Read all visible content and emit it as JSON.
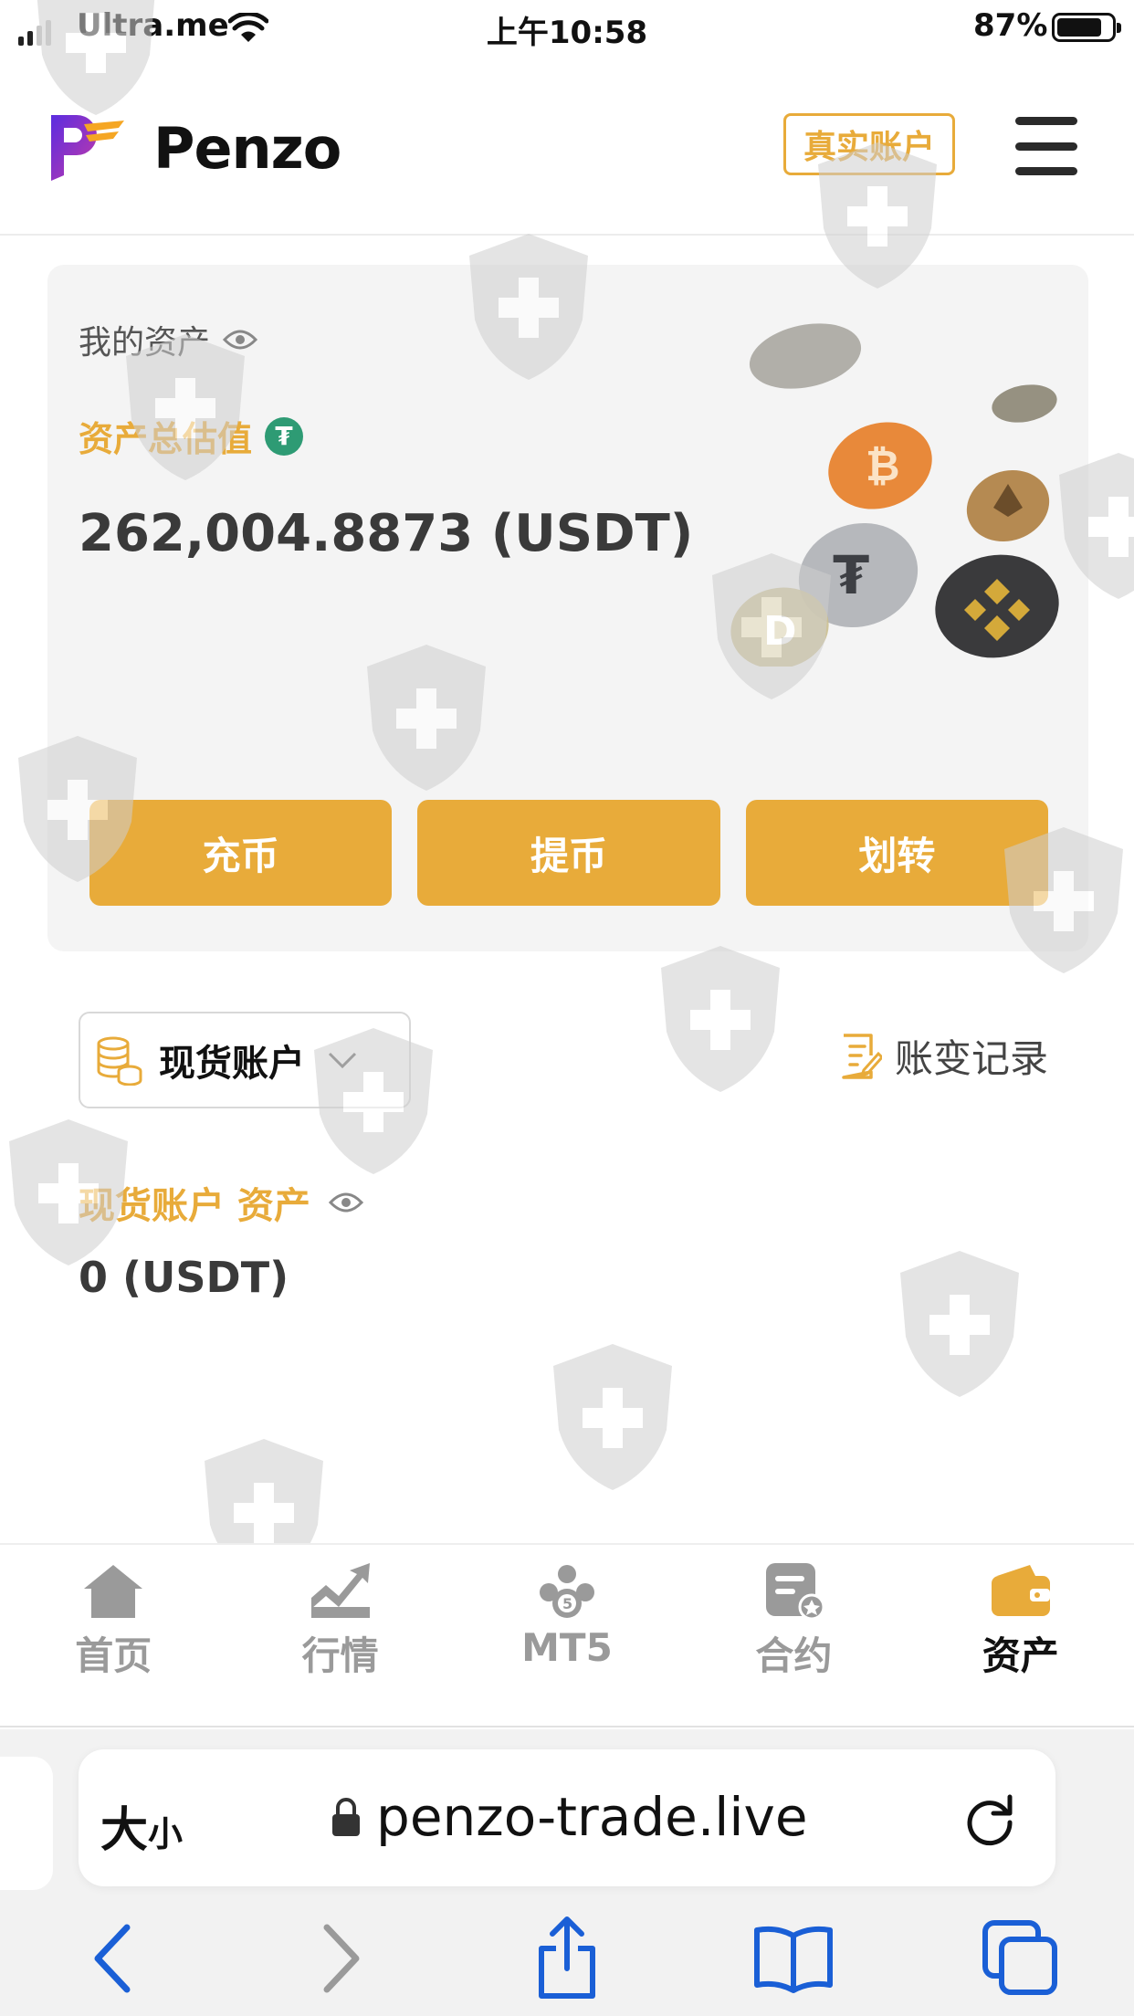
{
  "status_bar": {
    "carrier": "Ultra.me",
    "time": "上午10:58",
    "battery_percent": "87%",
    "battery_level": 0.87
  },
  "header": {
    "brand": "Penzo",
    "account_button": "真实账户"
  },
  "asset_card": {
    "my_assets_label": "我的资产",
    "total_label": "资产总估值",
    "tether_symbol": "₮",
    "total_value": "262,004.8873 (USDT)",
    "buttons": {
      "deposit": "充币",
      "withdraw": "提币",
      "transfer": "划转"
    }
  },
  "account_section": {
    "selected_account": "现货账户",
    "records_link": "账变记录",
    "spot_assets_label": "现货账户 资产",
    "spot_assets_value": "0 (USDT)"
  },
  "bottom_nav": {
    "items": [
      {
        "label": "首页",
        "icon": "home-icon"
      },
      {
        "label": "行情",
        "icon": "chart-icon"
      },
      {
        "label": "MT5",
        "icon": "mt5-icon"
      },
      {
        "label": "合约",
        "icon": "contract-icon"
      },
      {
        "label": "资产",
        "icon": "wallet-icon",
        "active": true
      }
    ]
  },
  "browser": {
    "text_size_large": "大",
    "text_size_small": "小",
    "url": "penzo-trade.live"
  },
  "colors": {
    "accent": "#e8ab3a",
    "tether_green": "#2e9b74",
    "safari_blue": "#1a5fd6"
  }
}
